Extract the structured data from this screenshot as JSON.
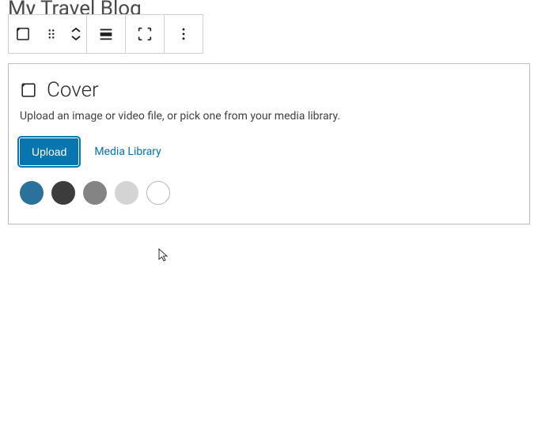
{
  "page": {
    "title": "My Travel Blog"
  },
  "toolbar": {
    "block_type": "cover-block",
    "drag": "drag-handle",
    "move": "move-up-down",
    "alignment": "alignment",
    "fullwidth": "full-width",
    "more": "more-options"
  },
  "cover": {
    "title": "Cover",
    "description": "Upload an image or video file, or pick one from your media library.",
    "upload_label": "Upload",
    "media_library_label": "Media Library",
    "colors": [
      "#2a729b",
      "#3c3c3c",
      "#848484",
      "#d4d4d4",
      "#ffffff"
    ]
  }
}
